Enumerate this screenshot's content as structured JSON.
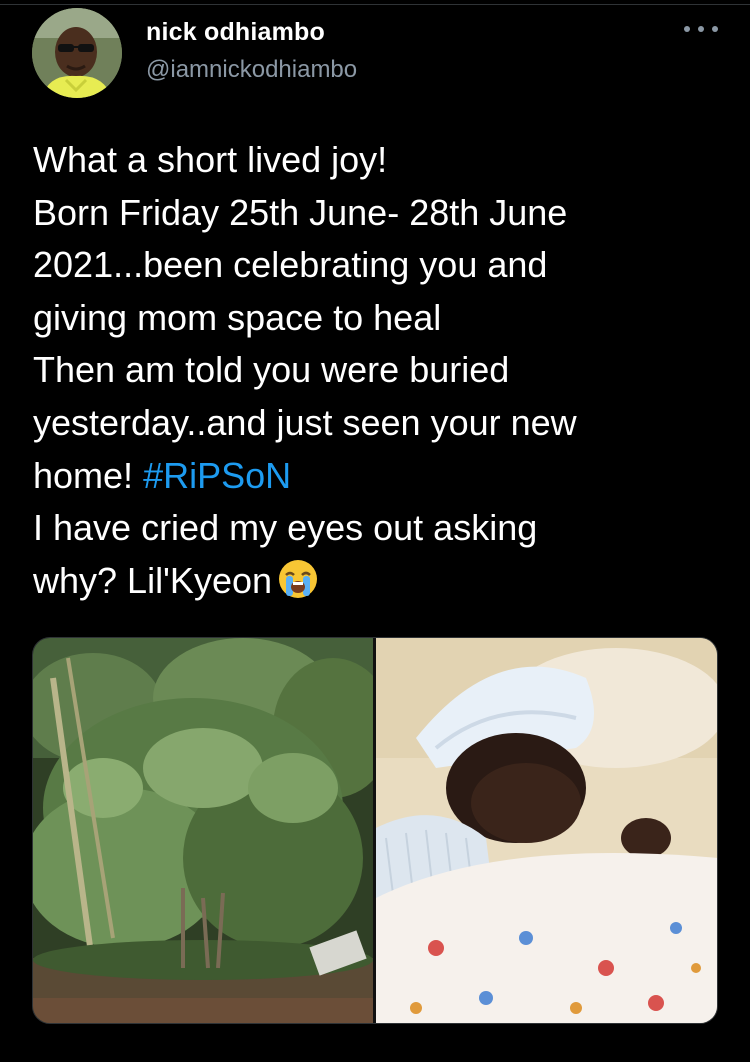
{
  "tweet": {
    "author": {
      "display_name": "nick odhiambo",
      "handle": "@iamnickodhiambo",
      "avatar_icon": "profile-photo"
    },
    "more_icon": "ellipsis-icon",
    "text_lines": [
      "What a short lived joy!",
      "Born Friday 25th June- 28th June",
      "2021...been celebrating you and",
      "giving mom space to heal",
      "Then am told you were buried",
      "yesterday..and just seen your new",
      "home!",
      "I have cried my eyes out asking",
      "why? Lil'Kyeon"
    ],
    "hashtag": "#RiPSoN",
    "emoji": "loudly-crying-face",
    "media": [
      {
        "description_icon": "photo-shrub"
      },
      {
        "description_icon": "photo-newborn"
      }
    ]
  },
  "colors": {
    "background": "#000000",
    "text": "#ffffff",
    "secondary": "#8b98a5",
    "link": "#1d9bf0"
  }
}
